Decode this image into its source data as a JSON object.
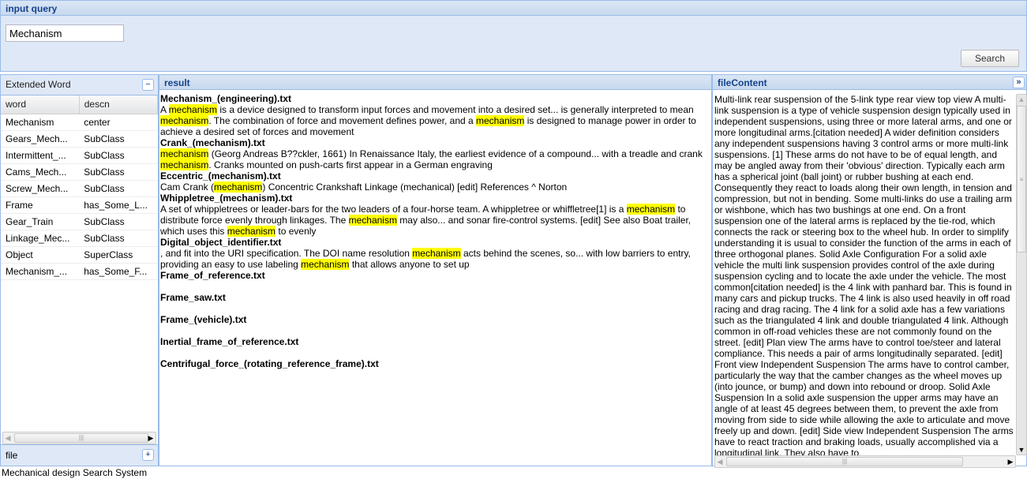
{
  "query_panel": {
    "title": "input query",
    "query_value": "Mechanism",
    "search_label": "Search"
  },
  "extended": {
    "title": "Extended Word",
    "collapse_icon": "minus-icon",
    "columns": [
      "word",
      "descn"
    ],
    "rows": [
      [
        "Mechanism",
        "center"
      ],
      [
        "Gears_Mech...",
        "SubClass"
      ],
      [
        "Intermittent_...",
        "SubClass"
      ],
      [
        "Cams_Mech...",
        "SubClass"
      ],
      [
        "Screw_Mech...",
        "SubClass"
      ],
      [
        "Frame",
        "has_Some_L..."
      ],
      [
        "Gear_Train",
        "SubClass"
      ],
      [
        "Linkage_Mec...",
        "SubClass"
      ],
      [
        "Object",
        "SuperClass"
      ],
      [
        "Mechanism_...",
        "has_Some_F..."
      ]
    ]
  },
  "file_panel": {
    "title": "file",
    "expand_icon": "plus-icon"
  },
  "result": {
    "title": "result",
    "highlight_color": "#ffff00",
    "items": [
      {
        "title": "Mechanism_(engineering).txt",
        "segments": [
          {
            "t": "A "
          },
          {
            "t": "mechanism",
            "h": true
          },
          {
            "t": " is a device designed to transform input forces and movement into a desired set... is generally interpreted to mean "
          },
          {
            "t": "mechanism",
            "h": true
          },
          {
            "t": ". The combination of force and movement defines power, and a "
          },
          {
            "t": "mechanism",
            "h": true
          },
          {
            "t": " is designed to manage power in order to achieve a desired set of forces and movement"
          }
        ]
      },
      {
        "title": "Crank_(mechanism).txt",
        "segments": [
          {
            "t": "mechanism",
            "h": true
          },
          {
            "t": " (Georg Andreas B??ckler, 1661) In Renaissance Italy, the earliest evidence of a compound... with a treadle and crank "
          },
          {
            "t": "mechanism",
            "h": true
          },
          {
            "t": ". Cranks mounted on push-carts first appear in a German engraving"
          }
        ]
      },
      {
        "title": "Eccentric_(mechanism).txt",
        "segments": [
          {
            "t": "Cam Crank ("
          },
          {
            "t": "mechanism",
            "h": true
          },
          {
            "t": ") Concentric Crankshaft Linkage (mechanical) [edit] References ^ Norton"
          }
        ]
      },
      {
        "title": "Whippletree_(mechanism).txt",
        "segments": [
          {
            "t": "A set of whippletrees or leader-bars for the two leaders of a four-horse team. A whippletree or whiffletree[1] is a "
          },
          {
            "t": "mechanism",
            "h": true
          },
          {
            "t": " to distribute force evenly through linkages. The "
          },
          {
            "t": "mechanism",
            "h": true
          },
          {
            "t": " may also... and sonar fire-control systems. [edit] See also Boat trailer, which uses this "
          },
          {
            "t": "mechanism",
            "h": true
          },
          {
            "t": " to evenly"
          }
        ]
      },
      {
        "title": "Digital_object_identifier.txt",
        "segments": [
          {
            "t": ", and fit into the URI specification. The DOI name resolution "
          },
          {
            "t": "mechanism",
            "h": true
          },
          {
            "t": " acts behind the scenes, so... with low barriers to entry, providing an easy to use labeling "
          },
          {
            "t": "mechanism",
            "h": true
          },
          {
            "t": " that allows anyone to set up"
          }
        ]
      },
      {
        "title": "Frame_of_reference.txt",
        "segments": []
      },
      {
        "title": "Frame_saw.txt",
        "segments": []
      },
      {
        "title": "Frame_(vehicle).txt",
        "segments": []
      },
      {
        "title": "Inertial_frame_of_reference.txt",
        "segments": []
      },
      {
        "title": "Centrifugal_force_(rotating_reference_frame).txt",
        "segments": []
      }
    ]
  },
  "file_content": {
    "title": "fileContent",
    "expand_icon": "double-chevron-right-icon",
    "text": "Multi-link rear suspension of the 5-link type rear view top view A multi-link suspension is a type of vehicle suspension design typically used in independent suspensions, using three or more lateral arms, and one or more longitudinal arms.[citation needed] A wider definition considers any independent suspensions having 3 control arms or more multi-link suspensions. [1] These arms do not have to be of equal length, and may be angled away from their 'obvious' direction. Typically each arm has a spherical joint (ball joint) or rubber bushing at each end. Consequently they react to loads along their own length, in tension and compression, but not in bending. Some multi-links do use a trailing arm or wishbone, which has two bushings at one end. On a front suspension one of the lateral arms is replaced by the tie-rod, which connects the rack or steering box to the wheel hub. In order to simplify understanding it is usual to consider the function of the arms in each of three orthogonal planes. Solid Axle Configuration For a solid axle vehicle the multi link suspension provides control of the axle during suspension cycling and to locate the axle under the vehicle. The most common[citation needed] is the 4 link with panhard bar. This is found in many cars and pickup trucks. The 4 link is also used heavily in off road racing and drag racing. The 4 link for a solid axle has a few variations such as the triangulated 4 link and double triangulated 4 link. Although common in off-road vehicles these are not commonly found on the street. [edit] Plan view The arms have to control toe/steer and lateral compliance. This needs a pair of arms longitudinally separated. [edit] Front view Independent Suspension The arms have to control camber, particularly the way that the camber changes as the wheel moves up (into jounce, or bump) and down into rebound or droop. Solid Axle Suspension In a solid axle suspension the upper arms may have an angle of at least 45 degrees between them, to prevent the axle from moving from side to side while allowing the axle to articulate and move freely up and down. [edit] Side view Independent Suspension The arms have to react traction and braking loads, usually accomplished via a longitudinal link. They also have to"
  },
  "status": "Mechanical design Search System"
}
